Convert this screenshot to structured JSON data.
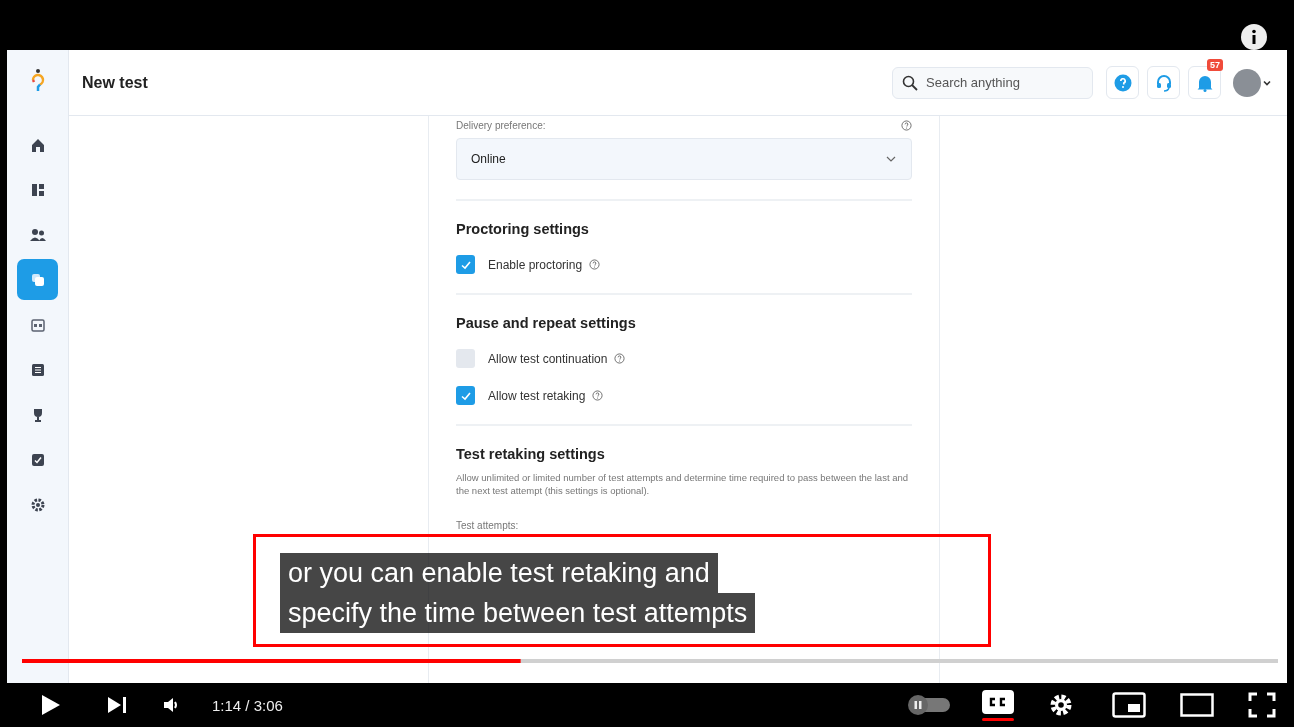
{
  "app": {
    "header": {
      "title": "New test",
      "search": {
        "placeholder": "Search anything"
      },
      "notification_count": "57"
    },
    "sidebar": {
      "items": [
        {
          "kind": "home",
          "selected": false
        },
        {
          "kind": "dashboard",
          "selected": false
        },
        {
          "kind": "users",
          "selected": false
        },
        {
          "kind": "tests",
          "selected": true
        },
        {
          "kind": "calendar",
          "selected": false
        },
        {
          "kind": "list",
          "selected": false
        },
        {
          "kind": "trophy",
          "selected": false
        },
        {
          "kind": "check",
          "selected": false
        },
        {
          "kind": "settings",
          "selected": false
        }
      ]
    },
    "form": {
      "delivery": {
        "label": "Delivery preference:",
        "value": "Online"
      },
      "sections": [
        {
          "title": "Proctoring settings",
          "checkboxes": [
            {
              "label": "Enable proctoring",
              "checked": true
            }
          ]
        },
        {
          "title": "Pause and repeat settings",
          "checkboxes": [
            {
              "label": "Allow test continuation",
              "checked": false
            },
            {
              "label": "Allow test retaking",
              "checked": true
            }
          ]
        }
      ],
      "retaking": {
        "title": "Test retaking settings",
        "description": "Allow unlimited or limited number of test attempts and determine time required to pass between the last and the next test attempt (this settings is optional).",
        "attempts_label": "Test attempts:"
      }
    }
  },
  "caption": {
    "lines": [
      "or you can enable test retaking and",
      "specify the time between test attempts"
    ]
  },
  "player": {
    "progress": {
      "level": 0.397
    },
    "time": "1:14 / 3:06",
    "autoplay": false,
    "captions_on": true
  }
}
